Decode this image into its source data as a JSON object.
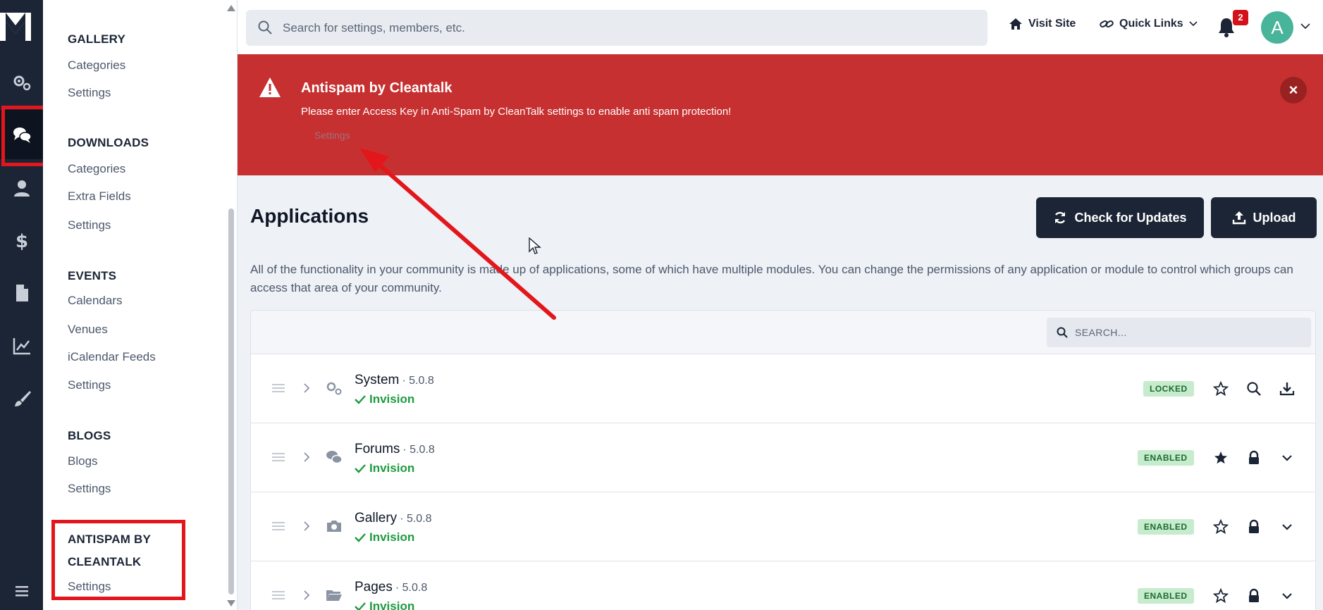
{
  "rail": {
    "items": [
      {
        "name": "apps-icon"
      },
      {
        "name": "community-icon"
      },
      {
        "name": "members-icon"
      },
      {
        "name": "commerce-icon"
      },
      {
        "name": "content-icon"
      },
      {
        "name": "stats-icon"
      },
      {
        "name": "customization-icon"
      },
      {
        "name": "menu-icon"
      }
    ]
  },
  "submenu": {
    "sections": [
      {
        "heading": "GALLERY",
        "links": [
          "Categories",
          "Settings"
        ]
      },
      {
        "heading": "DOWNLOADS",
        "links": [
          "Categories",
          "Extra Fields",
          "Settings"
        ]
      },
      {
        "heading": "EVENTS",
        "links": [
          "Calendars",
          "Venues",
          "iCalendar Feeds",
          "Settings"
        ]
      },
      {
        "heading": "BLOGS",
        "links": [
          "Blogs",
          "Settings"
        ]
      },
      {
        "heading_line1": "ANTISPAM BY",
        "heading_line2": "CLEANTALK",
        "links": [
          "Settings"
        ]
      }
    ]
  },
  "topbar": {
    "search_placeholder": "Search for settings, members, etc.",
    "visit_site": "Visit Site",
    "quick_links": "Quick Links",
    "notification_count": "2",
    "avatar_letter": "A"
  },
  "alert": {
    "title": "Antispam by Cleantalk",
    "message": "Please enter Access Key in Anti-Spam by CleanTalk settings to enable anti spam protection!",
    "link": "Settings",
    "close": "×",
    "color": "#c63030"
  },
  "main": {
    "title": "Applications",
    "check_updates": "Check for Updates",
    "upload": "Upload",
    "description": "All of the functionality in your community is made up of applications, some of which have multiple modules. You can change the permissions of any application or module to control which groups can access that area of your community.",
    "search_placeholder": "SEARCH...",
    "apps": [
      {
        "name": "System",
        "version": "· 5.0.8",
        "author": "Invision",
        "status": "LOCKED",
        "icon": "gears-icon"
      },
      {
        "name": "Forums",
        "version": "· 5.0.8",
        "author": "Invision",
        "status": "ENABLED",
        "icon": "chat-icon"
      },
      {
        "name": "Gallery",
        "version": "· 5.0.8",
        "author": "Invision",
        "status": "ENABLED",
        "icon": "camera-icon"
      },
      {
        "name": "Pages",
        "version": "· 5.0.8",
        "author": "Invision",
        "status": "ENABLED",
        "icon": "folder-icon"
      }
    ]
  },
  "colors": {
    "rail": "#1b2536",
    "annotation": "#e3161b",
    "success": "#1e9b3f"
  }
}
